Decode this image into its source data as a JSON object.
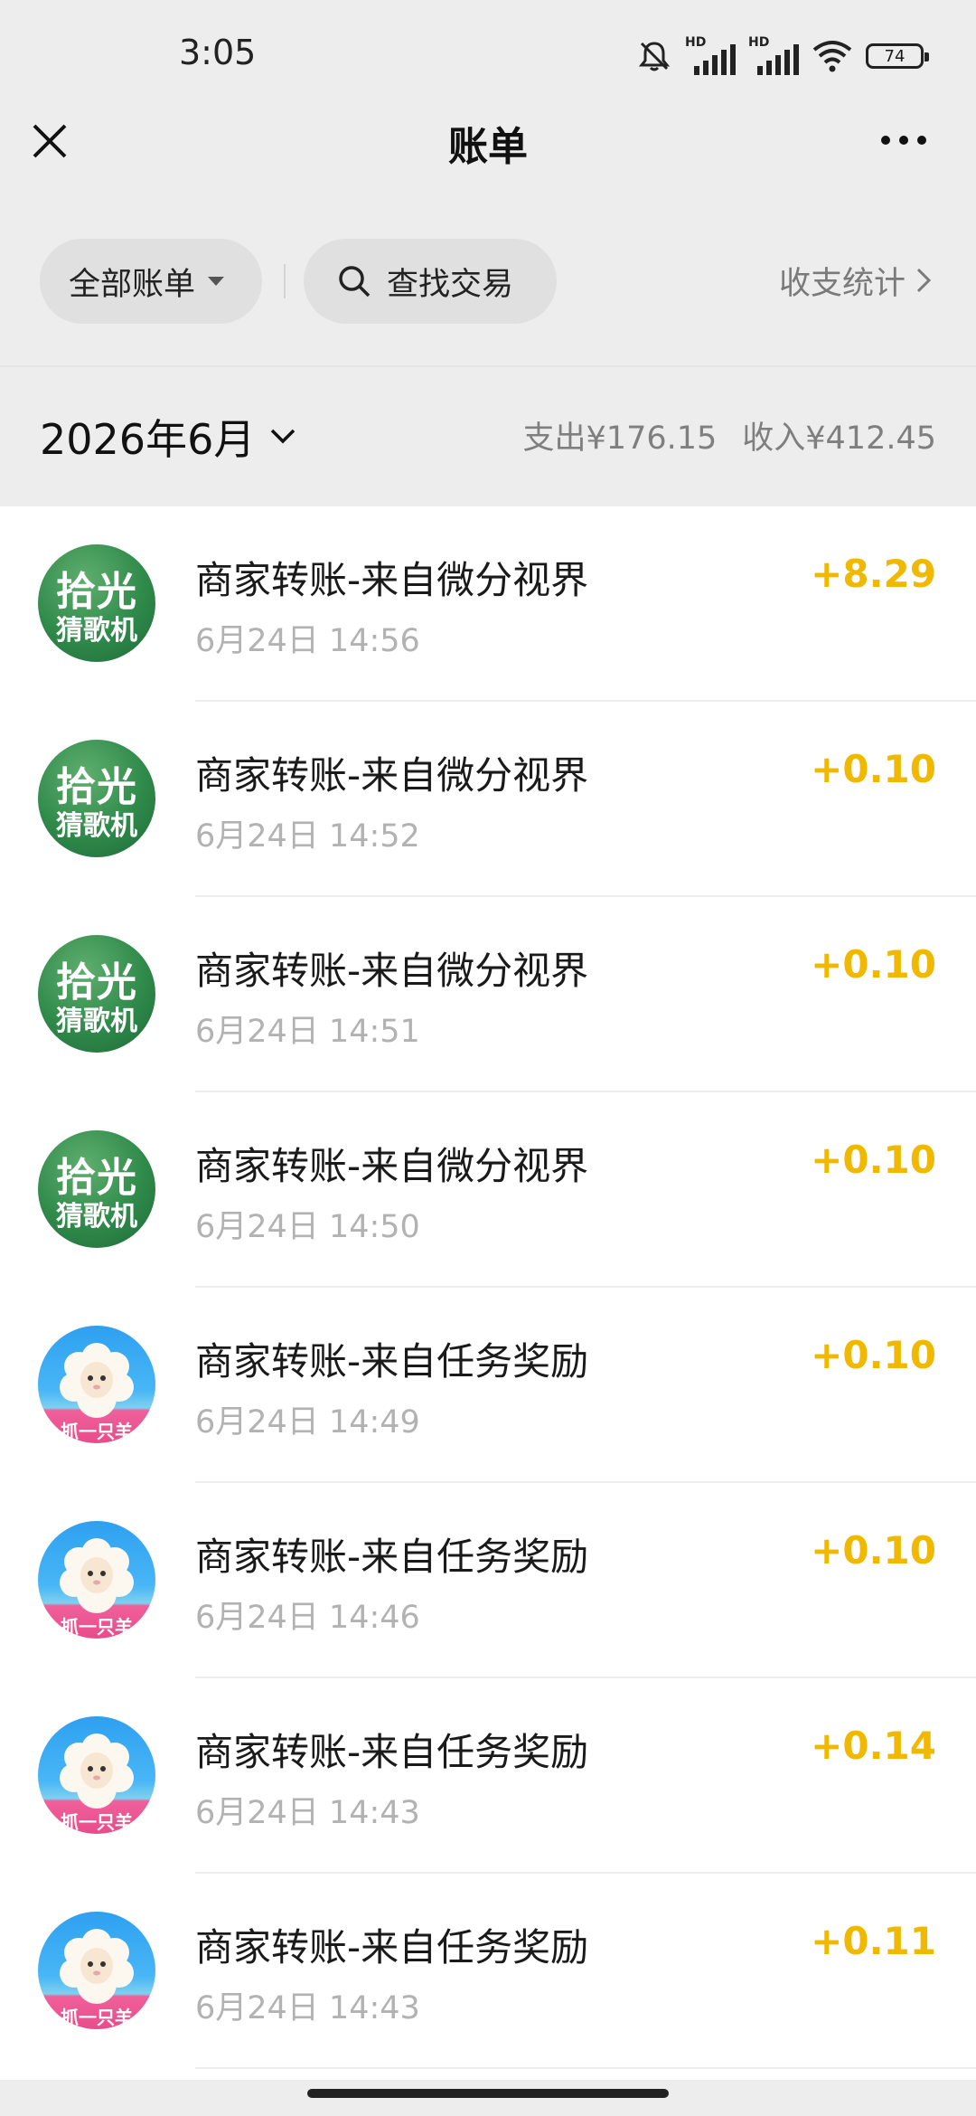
{
  "status_bar": {
    "time": "3:05",
    "signal_label_1": "HD",
    "signal_label_2": "HD",
    "battery": "74",
    "icons": [
      "mute-icon",
      "signal-icon",
      "signal-icon",
      "wifi-icon",
      "battery-icon"
    ]
  },
  "nav": {
    "title": "账单",
    "close_icon": "close-icon",
    "more_icon": "more-icon"
  },
  "filters": {
    "all_bills": "全部账单",
    "search": "查找交易",
    "stats": "收支统计"
  },
  "month_header": {
    "month": "2026年6月",
    "expense": "支出¥176.15",
    "income": "收入¥412.45"
  },
  "transactions": [
    {
      "avatar": "拾光猜歌机",
      "avatar_line1": "拾光",
      "avatar_line2": "猜歌机",
      "title": "商家转账-来自微分视界",
      "time": "6月24日 14:56",
      "amount": "+8.29"
    },
    {
      "avatar": "拾光猜歌机",
      "avatar_line1": "拾光",
      "avatar_line2": "猜歌机",
      "title": "商家转账-来自微分视界",
      "time": "6月24日 14:52",
      "amount": "+0.10"
    },
    {
      "avatar": "拾光猜歌机",
      "avatar_line1": "拾光",
      "avatar_line2": "猜歌机",
      "title": "商家转账-来自微分视界",
      "time": "6月24日 14:51",
      "amount": "+0.10"
    },
    {
      "avatar": "拾光猜歌机",
      "avatar_line1": "拾光",
      "avatar_line2": "猜歌机",
      "title": "商家转账-来自微分视界",
      "time": "6月24日 14:50",
      "amount": "+0.10"
    },
    {
      "avatar": "抓一只羊",
      "avatar_line1": "抓一只羊",
      "title": "商家转账-来自任务奖励",
      "time": "6月24日 14:49",
      "amount": "+0.10"
    },
    {
      "avatar": "抓一只羊",
      "avatar_line1": "抓一只羊",
      "title": "商家转账-来自任务奖励",
      "time": "6月24日 14:46",
      "amount": "+0.10"
    },
    {
      "avatar": "抓一只羊",
      "avatar_line1": "抓一只羊",
      "title": "商家转账-来自任务奖励",
      "time": "6月24日 14:43",
      "amount": "+0.14"
    },
    {
      "avatar": "抓一只羊",
      "avatar_line1": "抓一只羊",
      "title": "商家转账-来自任务奖励",
      "time": "6月24日 14:43",
      "amount": "+0.11"
    }
  ],
  "colors": {
    "income_amount": "#f0b800",
    "background": "#ededed"
  }
}
